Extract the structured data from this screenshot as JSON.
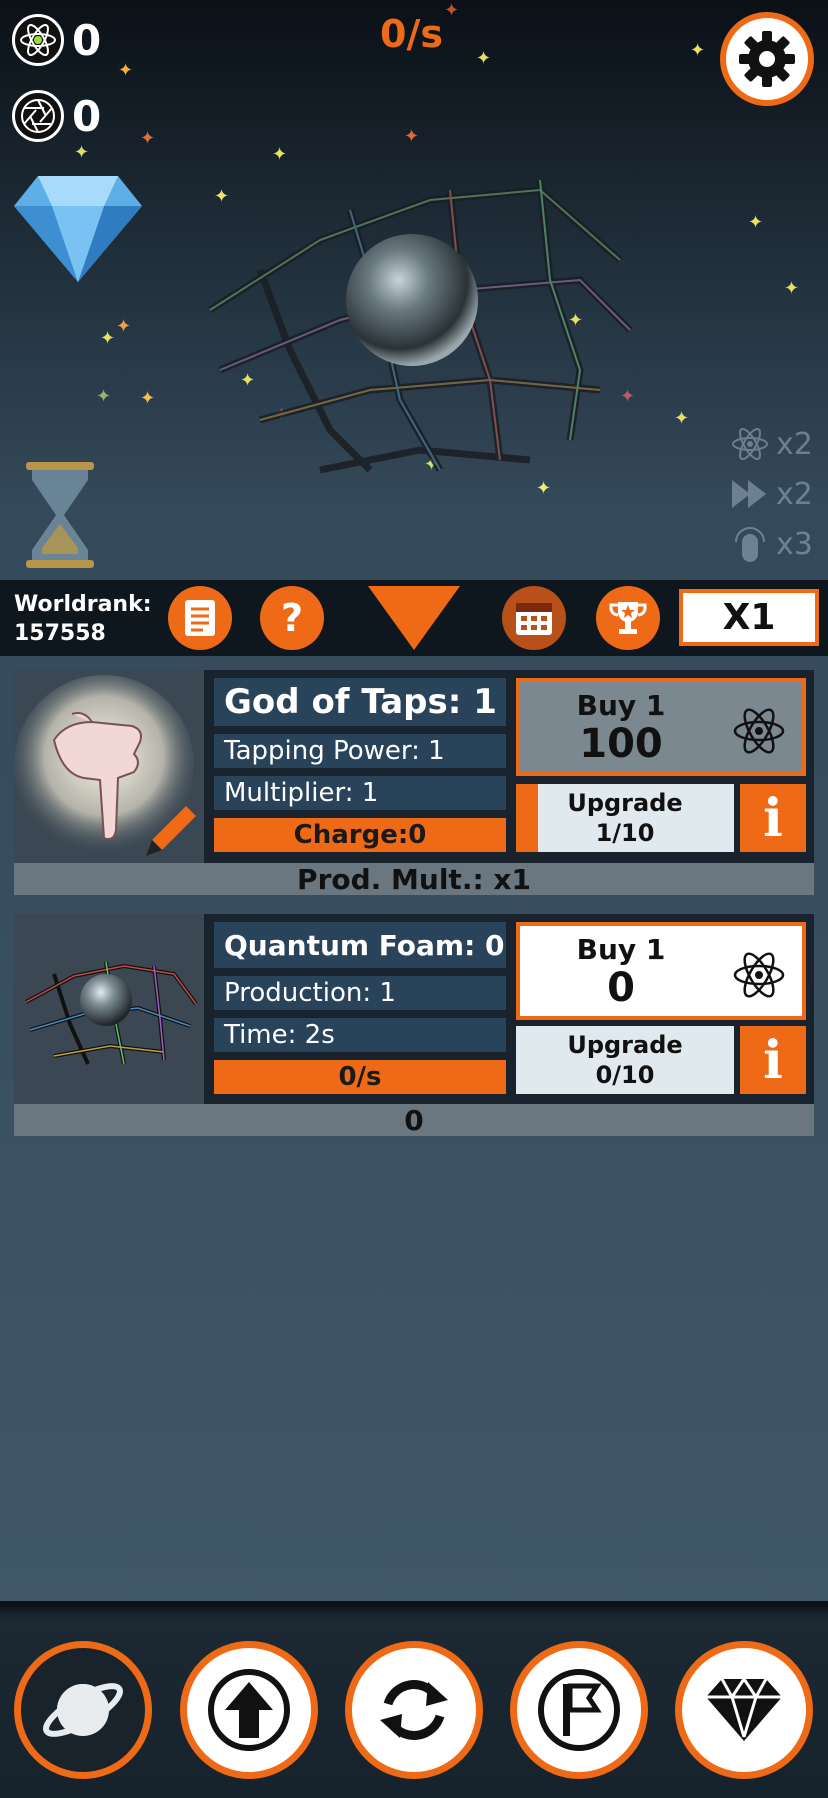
{
  "hud": {
    "atoms_count": "0",
    "antimatter_count": "0",
    "rate": "0/s"
  },
  "boosts": [
    {
      "icon": "atom-icon",
      "label": "x2"
    },
    {
      "icon": "fast-forward-icon",
      "label": "x2"
    },
    {
      "icon": "finger-tap-icon",
      "label": "x3"
    }
  ],
  "rankbar": {
    "worldrank_label": "Worldrank:",
    "worldrank_value": "157558",
    "multiplier_button": "X1"
  },
  "generators": [
    {
      "title": "God of Taps: 1",
      "stat1": "Tapping Power: 1",
      "stat2": "Multiplier: 1",
      "bar": "Charge:0",
      "buy_label": "Buy 1",
      "buy_cost": "100",
      "upgrade_label": "Upgrade",
      "upgrade_progress": "1/10",
      "upgrade_fraction": 0.1,
      "info": "i",
      "footer": "Prod. Mult.:  x1",
      "buy_enabled": false
    },
    {
      "title": "Quantum Foam:  0",
      "stat1": "Production: 1",
      "stat2": "Time: 2s",
      "bar": "0/s",
      "buy_label": "Buy 1",
      "buy_cost": "0",
      "upgrade_label": "Upgrade",
      "upgrade_progress": "0/10",
      "upgrade_fraction": 0,
      "info": "i",
      "footer": "0",
      "buy_enabled": true
    }
  ],
  "nav": [
    {
      "icon": "planet-icon",
      "active": true
    },
    {
      "icon": "upgrade-arrow-icon",
      "active": false
    },
    {
      "icon": "reset-cycle-icon",
      "active": false
    },
    {
      "icon": "flag-icon",
      "active": false
    },
    {
      "icon": "gem-shop-icon",
      "active": false
    }
  ],
  "colors": {
    "accent": "#ee6a16",
    "panel": "#28435a",
    "card_bg": "#18232d"
  }
}
